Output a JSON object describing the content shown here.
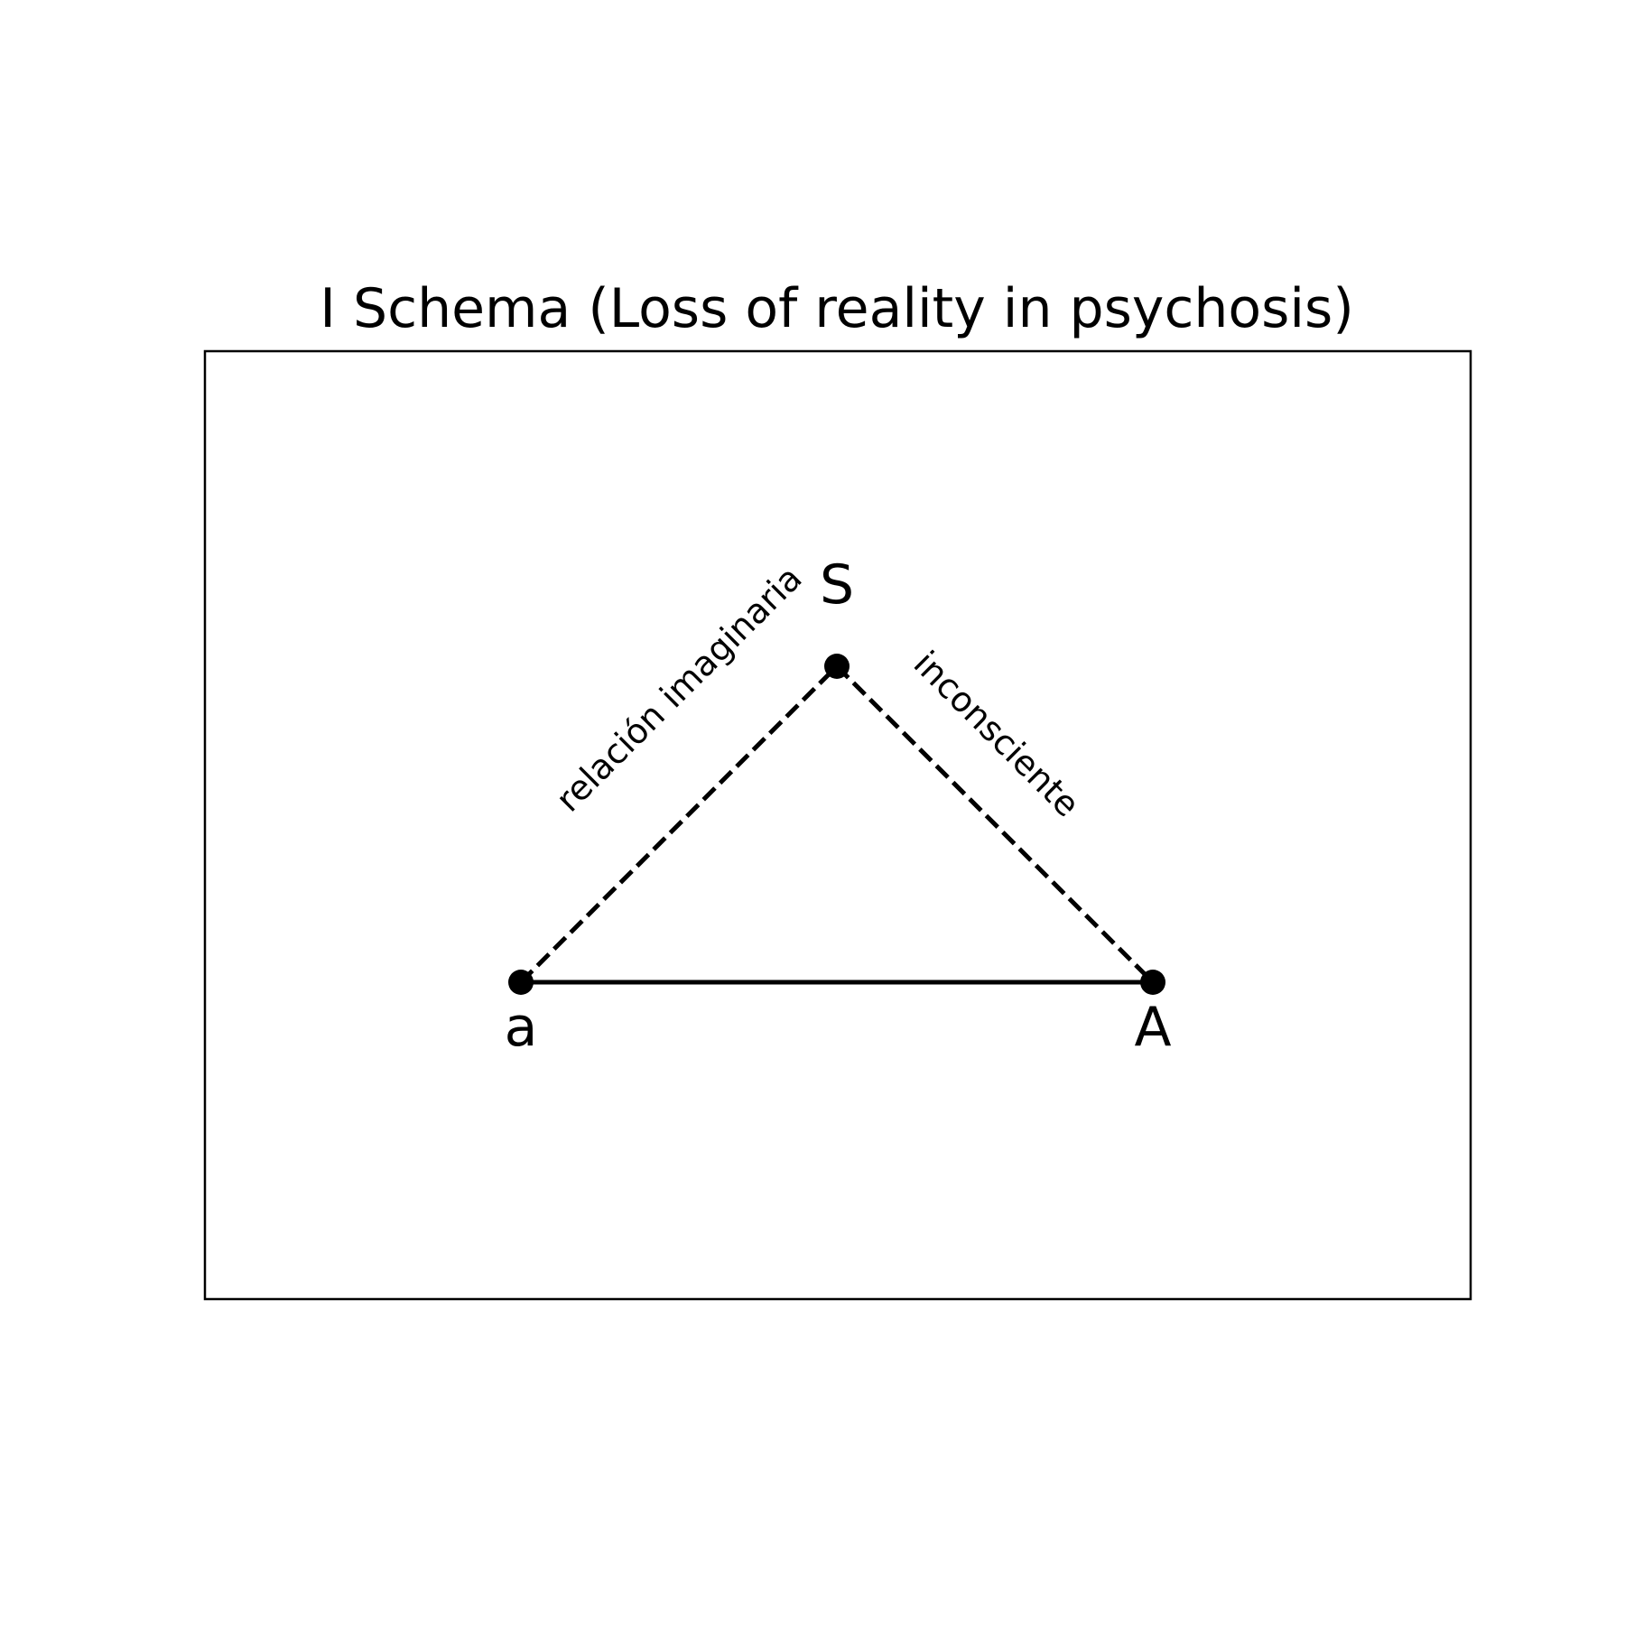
{
  "diagram": {
    "title": "I Schema (Loss of reality in psychosis)",
    "color": "#000000",
    "background": "#ffffff",
    "nodes": {
      "S": {
        "label": "S"
      },
      "a": {
        "label": "a"
      },
      "A": {
        "label": "A"
      }
    },
    "edges": [
      {
        "id": "a-S",
        "from": "a",
        "to": "S",
        "style": "dashed",
        "label": "relación imaginaria"
      },
      {
        "id": "S-A",
        "from": "S",
        "to": "A",
        "style": "dashed",
        "label": "inconsciente"
      },
      {
        "id": "a-A",
        "from": "a",
        "to": "A",
        "style": "solid",
        "label": ""
      }
    ]
  }
}
